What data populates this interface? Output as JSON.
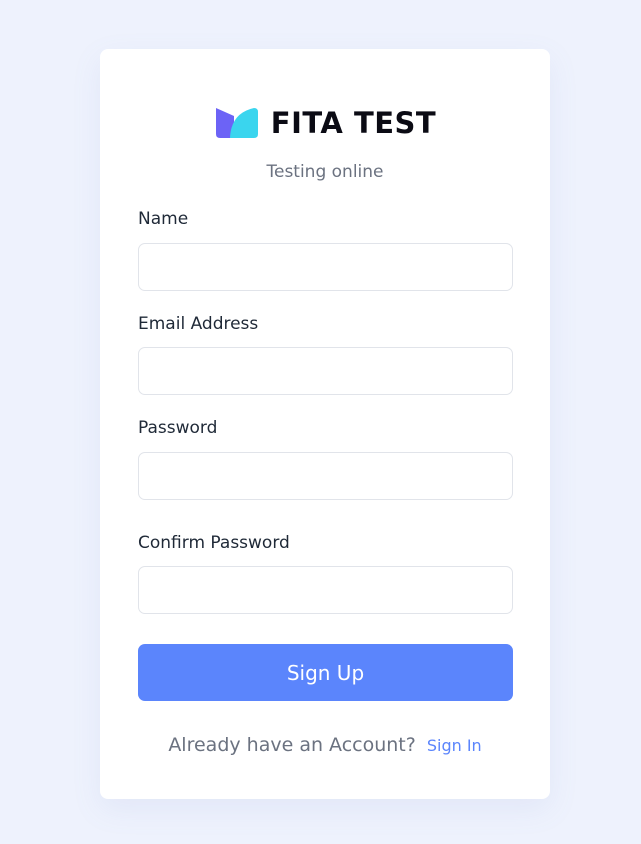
{
  "brand": {
    "logo_icon": "book-icon",
    "name": "FITA TEST",
    "tagline": "Testing online",
    "colors": {
      "logo_left": "#6c63f6",
      "logo_right": "#3ad5ee",
      "accent": "#5b85fc"
    }
  },
  "form": {
    "fields": [
      {
        "label": "Name",
        "value": "",
        "placeholder": ""
      },
      {
        "label": "Email Address",
        "value": "",
        "placeholder": ""
      },
      {
        "label": "Password",
        "value": "",
        "placeholder": ""
      },
      {
        "label": "Confirm Password",
        "value": "",
        "placeholder": ""
      }
    ],
    "submit_label": "Sign Up"
  },
  "footer": {
    "prompt": "Already have an Account?",
    "link_label": "Sign In"
  }
}
